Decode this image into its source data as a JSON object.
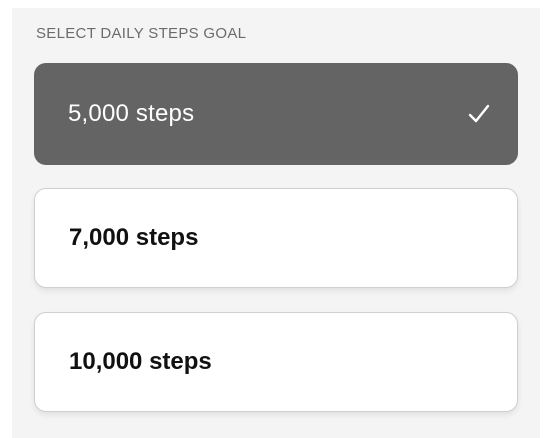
{
  "heading": "SELECT DAILY STEPS GOAL",
  "options": [
    {
      "label": "5,000 steps",
      "selected": true
    },
    {
      "label": "7,000 steps",
      "selected": false
    },
    {
      "label": "10,000 steps",
      "selected": false
    }
  ],
  "icons": {
    "selected_indicator": "check-icon"
  },
  "colors": {
    "selected_background": "#646464",
    "unselected_background": "#ffffff",
    "page_background": "#f4f4f4"
  }
}
